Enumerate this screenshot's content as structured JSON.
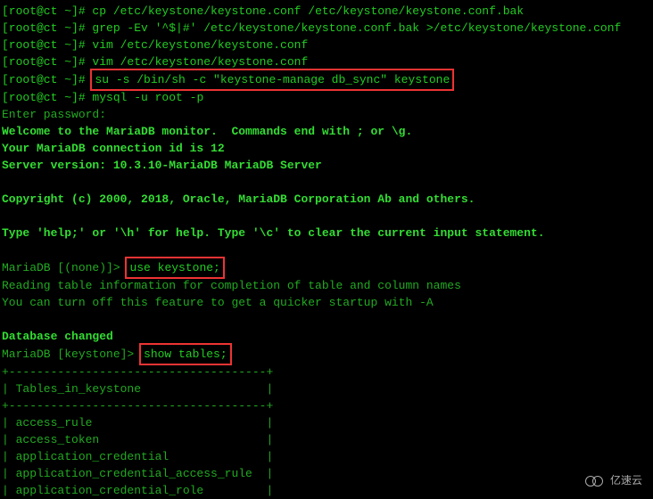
{
  "lines": {
    "l1_prompt": "[root@ct ~]# ",
    "l1_cmd": "cp /etc/keystone/keystone.conf /etc/keystone/keystone.conf.bak",
    "l2_prompt": "[root@ct ~]# ",
    "l2_cmd": "grep -Ev '^$|#' /etc/keystone/keystone.conf.bak >/etc/keystone/keystone.conf",
    "l3_prompt": "[root@ct ~]# ",
    "l3_cmd": "vim /etc/keystone/keystone.conf",
    "l4_prompt": "[root@ct ~]# ",
    "l4_cmd": "vim /etc/keystone/keystone.conf",
    "l5_prompt": "[root@ct ~]# ",
    "l5_boxed": "su -s /bin/sh -c \"keystone-manage db_sync\" keystone",
    "l6_prompt": "[root@ct ~]# ",
    "l6_cmd": "mysql -u root -p",
    "l7": "Enter password:",
    "l8": "Welcome to the MariaDB monitor.  Commands end with ; or \\g.",
    "l9": "Your MariaDB connection id is 12",
    "l10": "Server version: 10.3.10-MariaDB MariaDB Server",
    "l11": "Copyright (c) 2000, 2018, Oracle, MariaDB Corporation Ab and others.",
    "l12": "Type 'help;' or '\\h' for help. Type '\\c' to clear the current input statement.",
    "l13_prompt": "MariaDB [(none)]> ",
    "l13_boxed": "use keystone;",
    "l14": "Reading table information for completion of table and column names",
    "l15": "You can turn off this feature to get a quicker startup with -A",
    "l16": "Database changed",
    "l17_prompt": "MariaDB [keystone]> ",
    "l17_boxed": "show tables;",
    "t_border": "+-------------------------------------+",
    "t_header": "| Tables_in_keystone                  |",
    "t_r1": "| access_rule                         |",
    "t_r2": "| access_token                        |",
    "t_r3": "| application_credential              |",
    "t_r4": "| application_credential_access_rule  |",
    "t_r5": "| application_credential_role         |"
  },
  "watermark": "亿速云"
}
